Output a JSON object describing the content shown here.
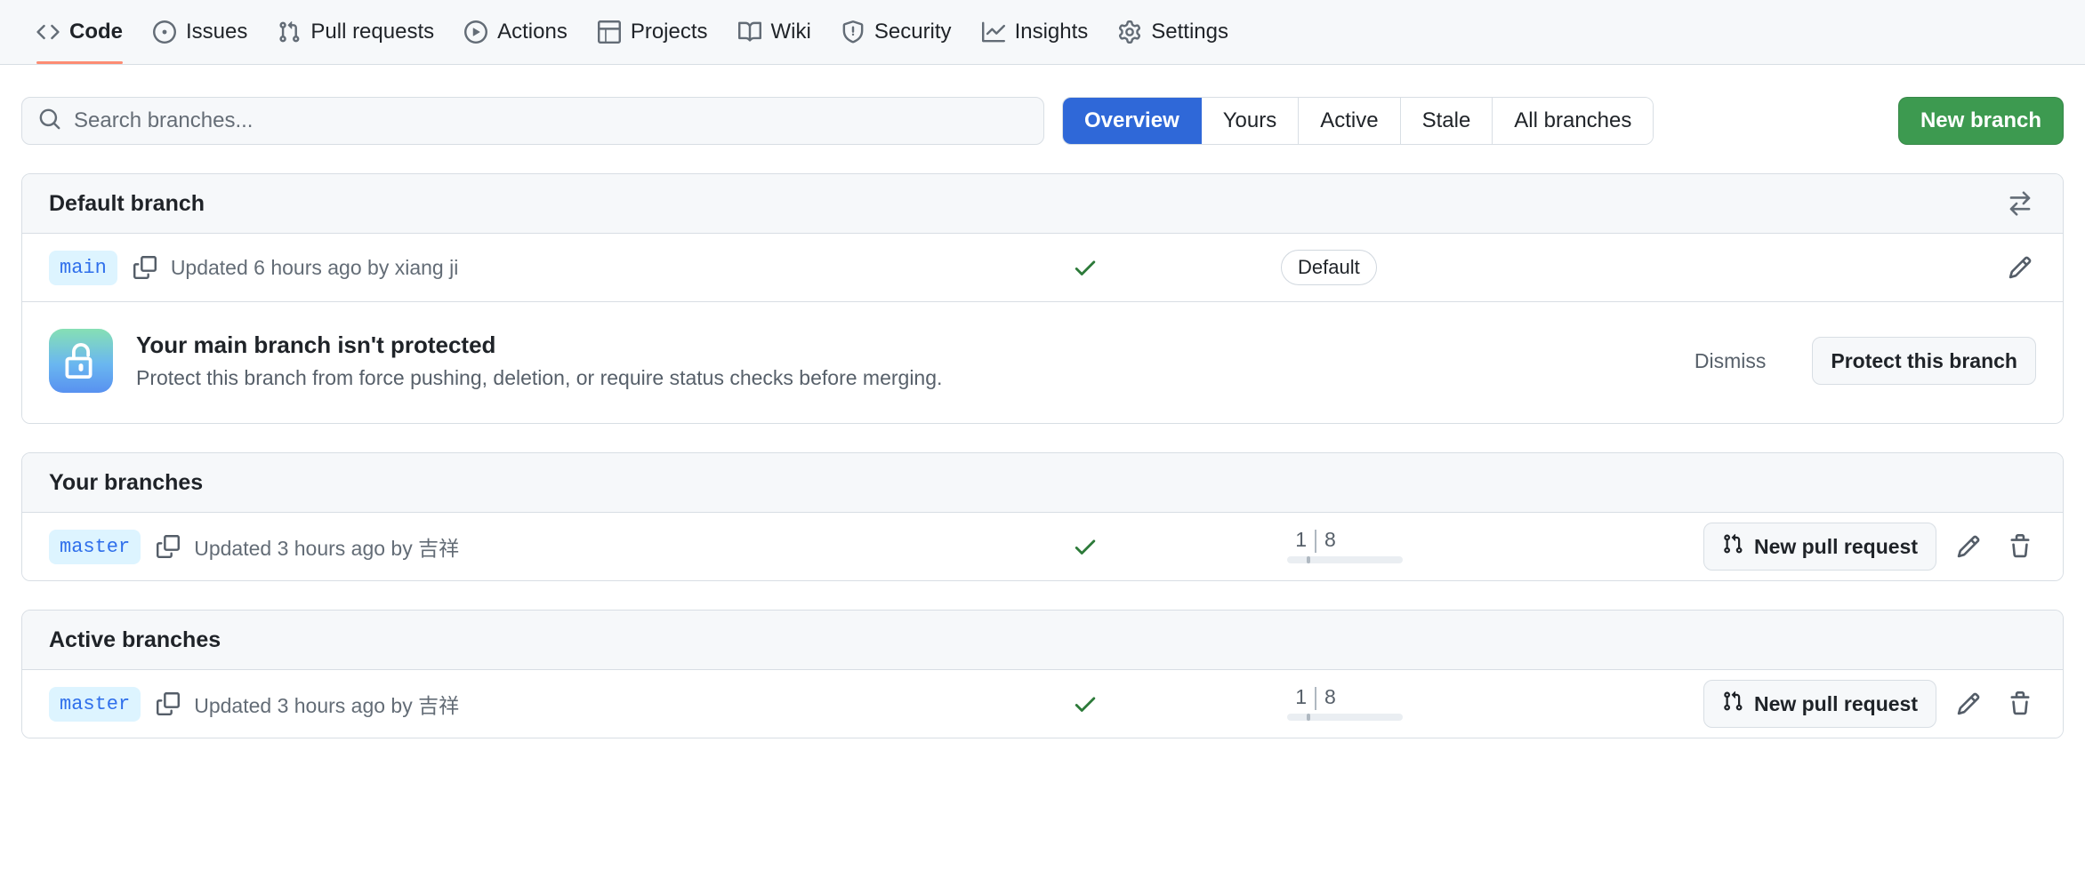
{
  "repo_nav": {
    "items": [
      {
        "label": "Code",
        "icon": "code-icon",
        "selected": true
      },
      {
        "label": "Issues",
        "icon": "issue-opened-icon",
        "selected": false
      },
      {
        "label": "Pull requests",
        "icon": "git-pull-request-icon",
        "selected": false
      },
      {
        "label": "Actions",
        "icon": "play-icon",
        "selected": false
      },
      {
        "label": "Projects",
        "icon": "table-icon",
        "selected": false
      },
      {
        "label": "Wiki",
        "icon": "book-icon",
        "selected": false
      },
      {
        "label": "Security",
        "icon": "shield-icon",
        "selected": false
      },
      {
        "label": "Insights",
        "icon": "graph-icon",
        "selected": false
      },
      {
        "label": "Settings",
        "icon": "gear-icon",
        "selected": false
      }
    ]
  },
  "controls": {
    "search": {
      "placeholder": "Search branches...",
      "value": "",
      "icon": "search-icon"
    },
    "filters": [
      {
        "label": "Overview",
        "active": true
      },
      {
        "label": "Yours",
        "active": false
      },
      {
        "label": "Active",
        "active": false
      },
      {
        "label": "Stale",
        "active": false
      },
      {
        "label": "All branches",
        "active": false
      }
    ],
    "new_branch_label": "New branch"
  },
  "sections": [
    {
      "title": "Default branch",
      "header_icon": "arrow-switch-icon",
      "row": {
        "branch": "main",
        "copy_icon": "copy-icon",
        "meta": "Updated 6 hours ago by xiang ji",
        "check_icon": "check-icon",
        "badge": "Default",
        "edit_icon": "pencil-icon"
      },
      "banner": {
        "icon": "unlock-icon",
        "title": "Your main branch isn't protected",
        "description": "Protect this branch from force pushing, deletion, or require status checks before merging.",
        "dismiss_label": "Dismiss",
        "action_label": "Protect this branch"
      }
    },
    {
      "title": "Your branches",
      "row": {
        "branch": "master",
        "copy_icon": "copy-icon",
        "meta": "Updated 3 hours ago by 吉祥",
        "check_icon": "check-icon",
        "ahead": "1",
        "behind": "8",
        "pr_label": "New pull request",
        "pr_icon": "git-pull-request-icon",
        "edit_icon": "pencil-icon",
        "delete_icon": "trash-icon"
      }
    },
    {
      "title": "Active branches",
      "row": {
        "branch": "master",
        "copy_icon": "copy-icon",
        "meta": "Updated 3 hours ago by 吉祥",
        "check_icon": "check-icon",
        "ahead": "1",
        "behind": "8",
        "pr_label": "New pull request",
        "pr_icon": "git-pull-request-icon",
        "edit_icon": "pencil-icon",
        "delete_icon": "trash-icon"
      }
    }
  ],
  "colors": {
    "accent_selected_tab": "#fd8c73",
    "filter_active_bg": "#2f68d8",
    "new_branch_bg": "#3d9a50",
    "branch_badge_bg": "#ddf4ff",
    "branch_badge_fg": "#2f6feb",
    "check_green": "#2c7a39",
    "header_bg": "#f6f8fa",
    "border": "#d8dee4"
  }
}
